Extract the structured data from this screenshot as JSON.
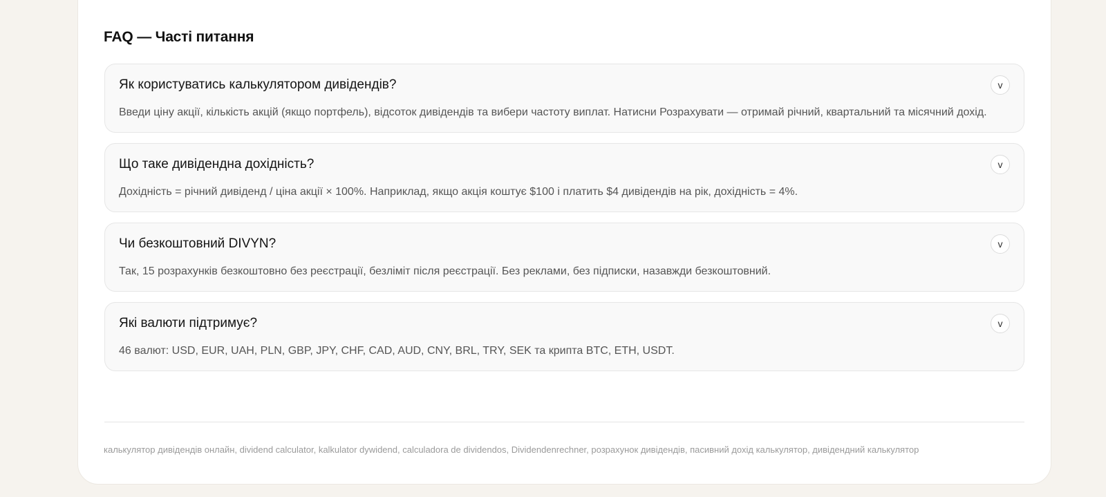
{
  "faq": {
    "title": "FAQ — Часті питання",
    "toggle_glyph": "v",
    "items": [
      {
        "question": "Як користуватись калькулятором дивідендів?",
        "answer": "Введи ціну акції, кількість акцій (якщо портфель), відсоток дивідендів та вибери частоту виплат. Натисни Розрахувати — отримай річний, квартальний та місячний дохід."
      },
      {
        "question": "Що таке дивідендна дохідність?",
        "answer": "Дохідність = річний дивіденд / ціна акції × 100%. Наприклад, якщо акція коштує $100 і платить $4 дивідендів на рік, дохідність = 4%."
      },
      {
        "question": "Чи безкоштовний DIVYN?",
        "answer": "Так, 15 розрахунків безкоштовно без реєстрації, безліміт після реєстрації. Без реклами, без підписки, назавжди безкоштовний."
      },
      {
        "question": "Які валюти підтримує?",
        "answer": "46 валют: USD, EUR, UAH, PLN, GBP, JPY, CHF, CAD, AUD, CNY, BRL, TRY, SEK та крипта BTC, ETH, USDT."
      }
    ]
  },
  "footer": {
    "keywords": "калькулятор дивідендів онлайн, dividend calculator, kalkulator dywidend, calculadora de dividendos, Dividendenrechner, розрахунок дивідендів, пасивний дохід калькулятор, дивідендний калькулятор"
  }
}
